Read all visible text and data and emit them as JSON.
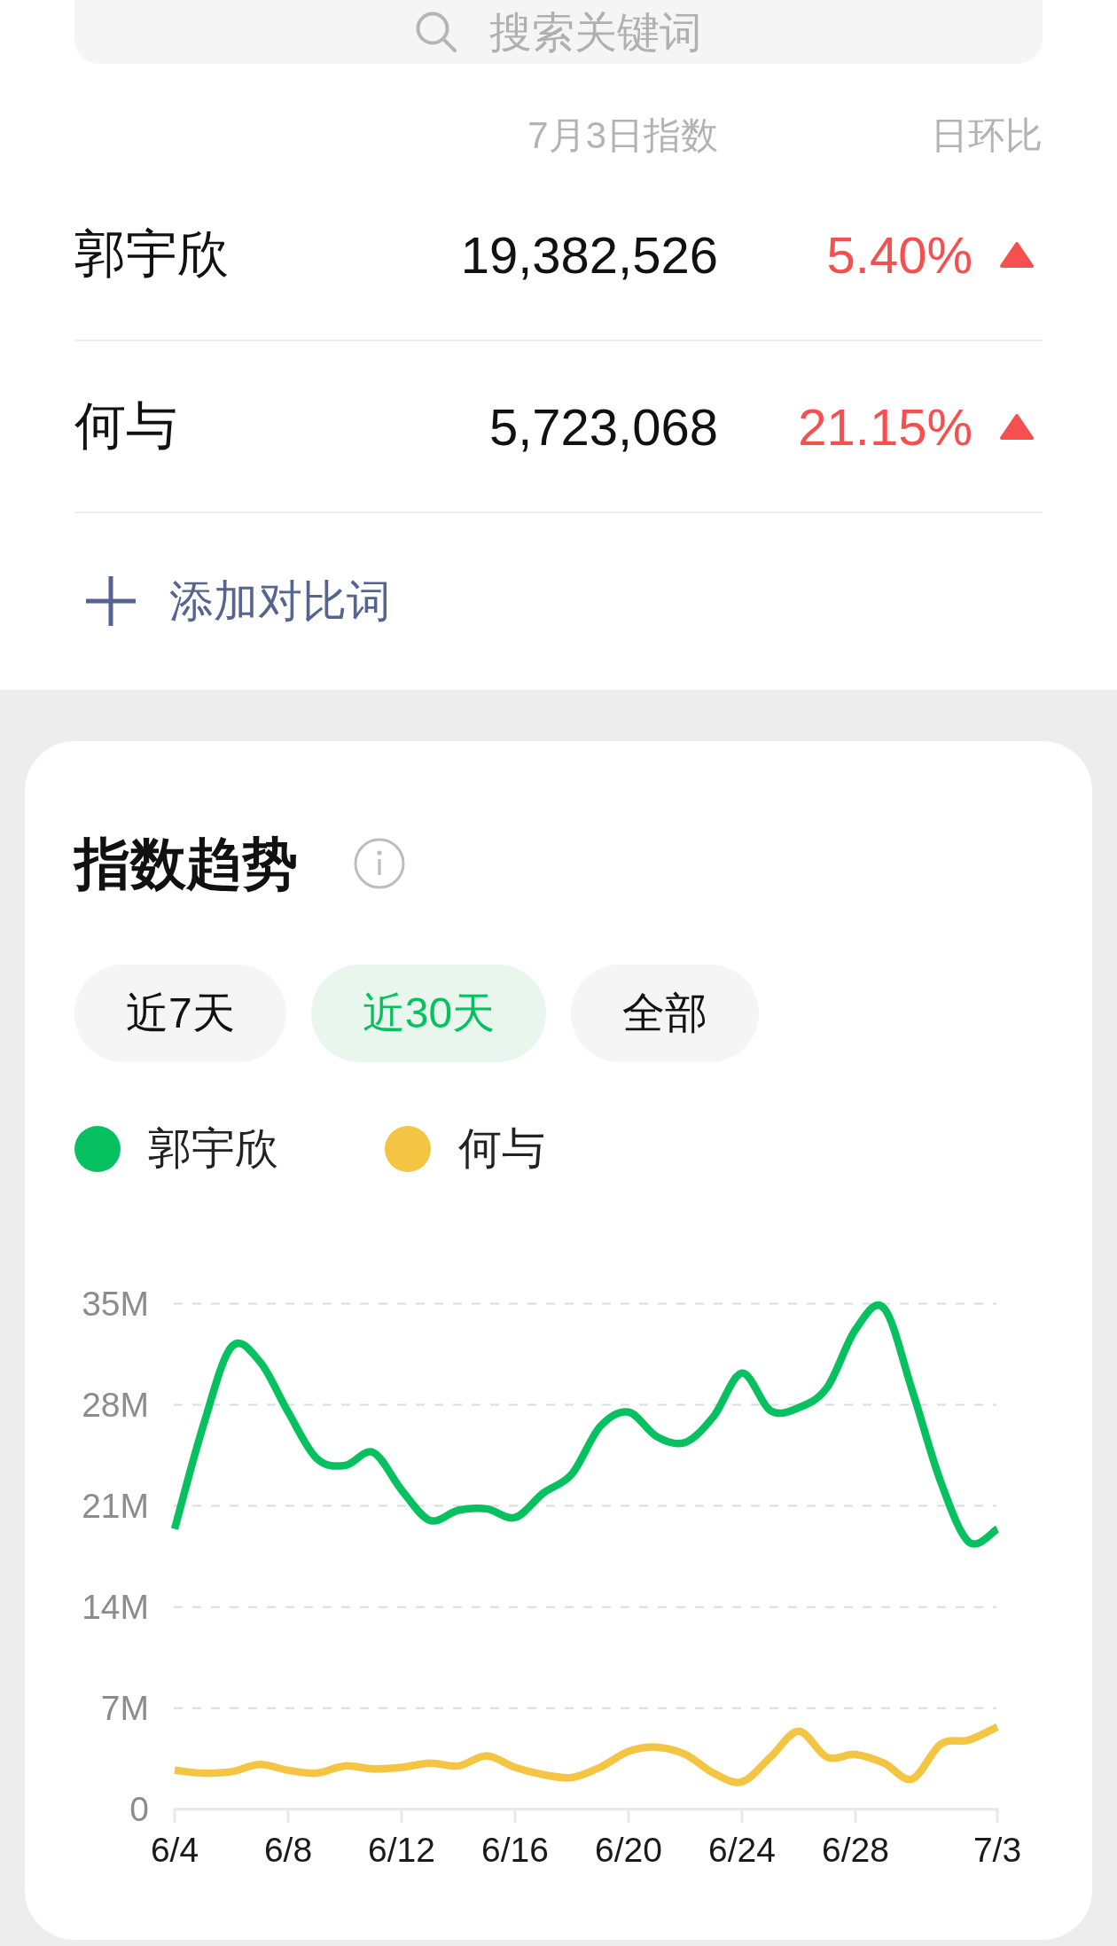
{
  "search": {
    "placeholder": "搜索关键词"
  },
  "comparison": {
    "columns": [
      "7月3日指数",
      "日环比"
    ],
    "rows": [
      {
        "name": "郭宇欣",
        "index": "19,382,526",
        "change": "5.40%",
        "rising": true
      },
      {
        "name": "何与",
        "index": "5,723,068",
        "change": "21.15%",
        "rising": true
      }
    ],
    "add_button": "添加对比词"
  },
  "trend": {
    "title": "指数趋势",
    "ranges": [
      {
        "label": "近7天",
        "selected": false
      },
      {
        "label": "近30天",
        "selected": true
      },
      {
        "label": "全部",
        "selected": false
      }
    ],
    "chart_data": {
      "type": "line",
      "categories": [
        "6/4",
        null,
        null,
        null,
        "6/8",
        null,
        null,
        null,
        "6/12",
        null,
        null,
        null,
        "6/16",
        null,
        null,
        null,
        "6/20",
        null,
        null,
        null,
        "6/24",
        null,
        null,
        null,
        "6/28",
        null,
        null,
        null,
        null,
        "7/3"
      ],
      "series": [
        {
          "name": "郭宇欣",
          "color": "#07c160",
          "values": [
            19.4,
            26.5,
            32.0,
            31.0,
            27.5,
            24.3,
            23.8,
            24.7,
            22.1,
            20.0,
            20.7,
            20.8,
            20.2,
            21.9,
            23.2,
            26.5,
            27.5,
            25.8,
            25.4,
            27.2,
            30.2,
            27.6,
            27.8,
            29.2,
            33.2,
            34.7,
            29.0,
            22.7,
            18.5,
            19.4
          ]
        },
        {
          "name": "何与",
          "color": "#f4c443",
          "values": [
            2.7,
            2.5,
            2.6,
            3.1,
            2.7,
            2.5,
            3.0,
            2.8,
            2.9,
            3.2,
            3.0,
            3.7,
            2.9,
            2.4,
            2.2,
            2.9,
            4.0,
            4.3,
            3.8,
            2.5,
            1.9,
            3.6,
            5.4,
            3.6,
            3.8,
            3.2,
            2.1,
            4.5,
            4.8,
            5.7
          ]
        }
      ],
      "ylim": [
        0,
        35
      ],
      "yticks": [
        0,
        {
          "value": 7,
          "label": "7M"
        },
        {
          "value": 14,
          "label": "14M"
        },
        {
          "value": 21,
          "label": "21M"
        },
        {
          "value": 28,
          "label": "28M"
        },
        {
          "value": 35,
          "label": "35M"
        }
      ],
      "grid": true
    }
  }
}
